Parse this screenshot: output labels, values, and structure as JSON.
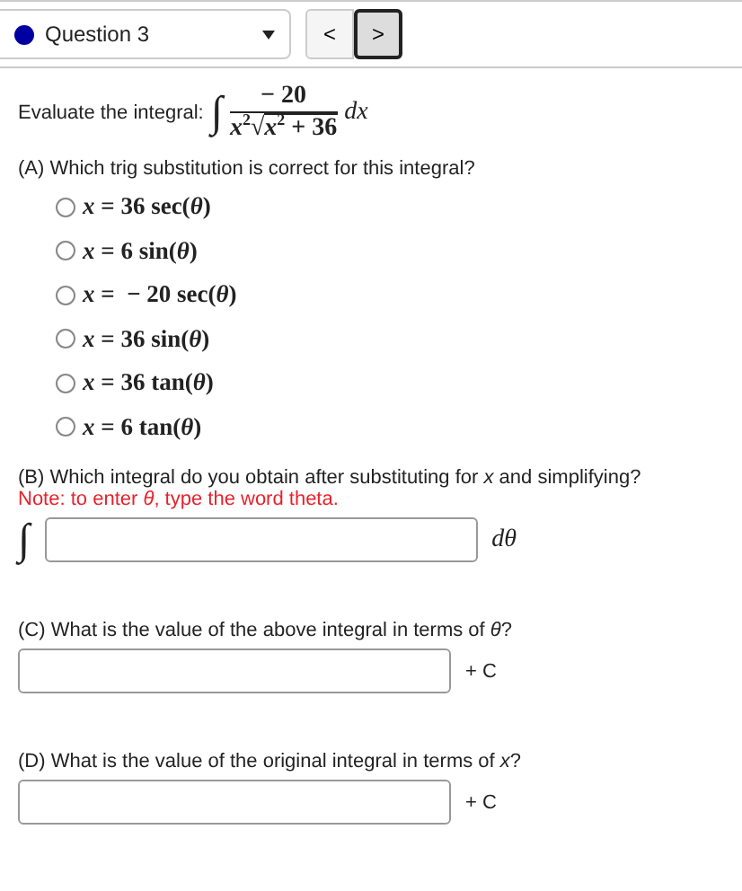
{
  "header": {
    "question_select": {
      "value": "Question 3",
      "color": "#0000a0"
    },
    "nav_buttons": [
      {
        "label": "<",
        "focused": false
      },
      {
        "label": ">",
        "focused": true
      }
    ]
  },
  "prompt": {
    "label": "Evaluate the integral:",
    "sign": "∫",
    "numerator": "− 20",
    "denominator_factor": "*x*$^{2}$",
    "radical": "√",
    "radicand": "*x*$^{2}$ + 36",
    "differential": "*dx*"
  },
  "part_a": {
    "question": "(A) Which trig substitution is correct for this integral?",
    "options": [
      {
        "text": "*x* = 36 sec(*θ*)",
        "selected": false
      },
      {
        "text": "*x* = 6 sin(*θ*)",
        "selected": false
      },
      {
        "text": "*x* =  − 20 sec(*θ*)",
        "selected": false
      },
      {
        "text": "*x* = 36 sin(*θ*)",
        "selected": false
      },
      {
        "text": "*x* = 36 tan(*θ*)",
        "selected": false
      },
      {
        "text": "*x* = 6 tan(*θ*)",
        "selected": false
      }
    ]
  },
  "part_b": {
    "question": "(B) Which integral do you obtain after substituting for *x* and simplifying?",
    "note": "Note: to enter *θ*, type the word theta.",
    "prefix": "∫",
    "suffix": "*dθ*"
  },
  "part_c": {
    "question": "(C) What is the value of the above integral in terms of *θ*?",
    "suffix": "+ C"
  },
  "part_d": {
    "question": "(D) What is the value of the original integral in terms of *x*?",
    "suffix": "+ C"
  }
}
